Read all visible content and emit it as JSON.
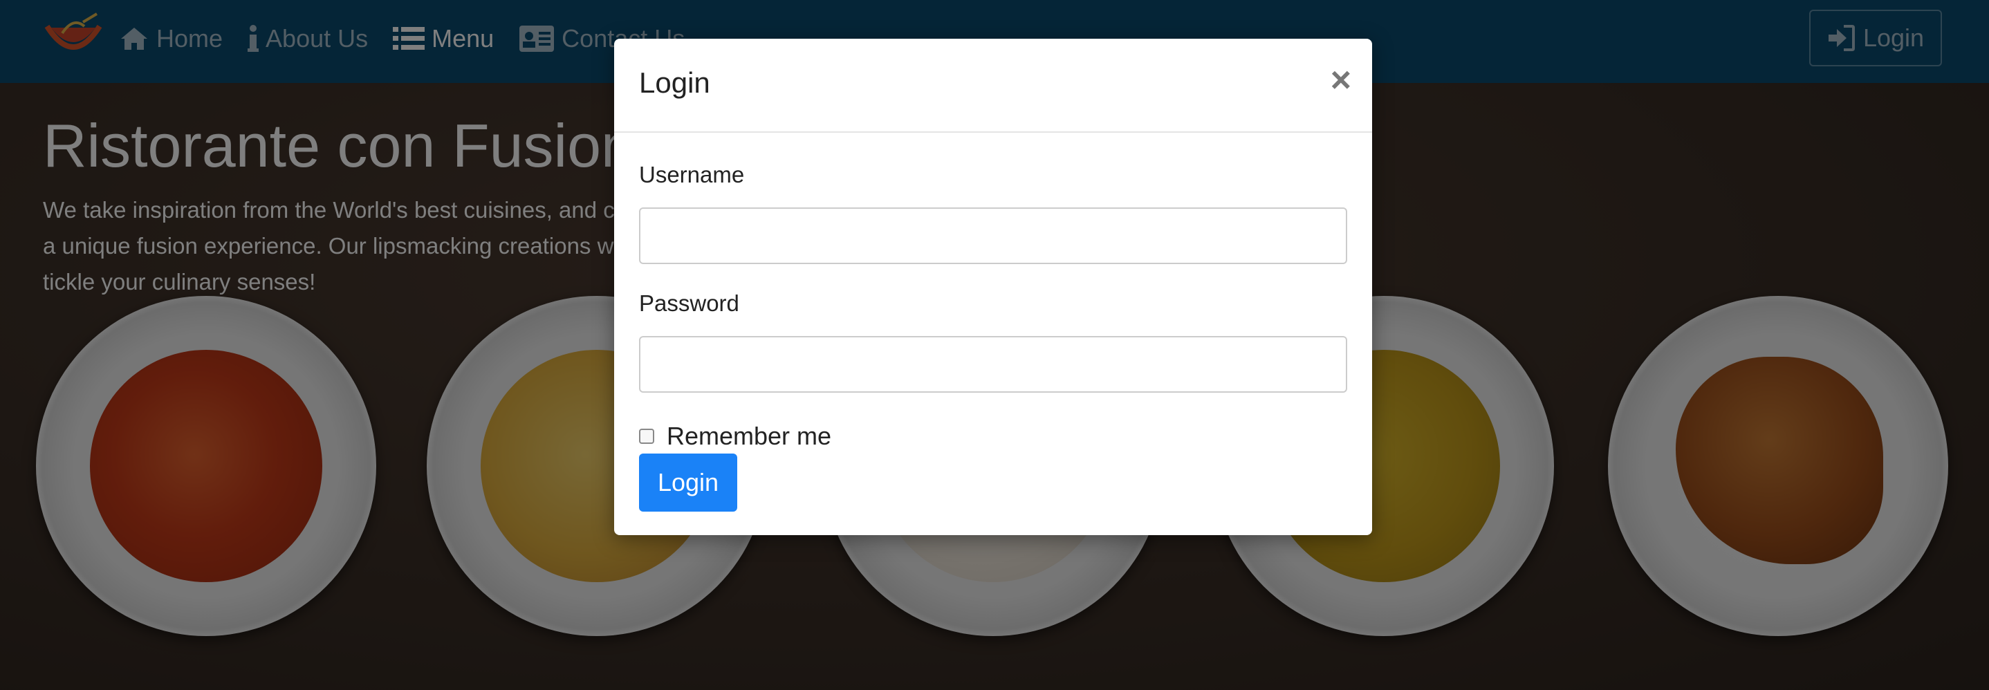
{
  "navbar": {
    "items": [
      {
        "label": "Home",
        "icon": "home-icon"
      },
      {
        "label": "About Us",
        "icon": "info-icon"
      },
      {
        "label": "Menu",
        "icon": "list-icon",
        "active": true
      },
      {
        "label": "Contact Us",
        "icon": "contact-card-icon"
      }
    ],
    "login_label": "Login"
  },
  "hero": {
    "title": "Ristorante con Fusion",
    "text": "We take inspiration from the World's best cuisines, and create a unique fusion experience. Our lipsmacking creations will tickle your culinary senses!"
  },
  "modal": {
    "title": "Login",
    "close_glyph": "×",
    "username_label": "Username",
    "username_value": "",
    "password_label": "Password",
    "password_value": "",
    "remember_label": "Remember me",
    "remember_checked": false,
    "submit_label": "Login"
  },
  "colors": {
    "navbar_bg": "#0b4a6e",
    "primary_button": "#1a82f7"
  }
}
